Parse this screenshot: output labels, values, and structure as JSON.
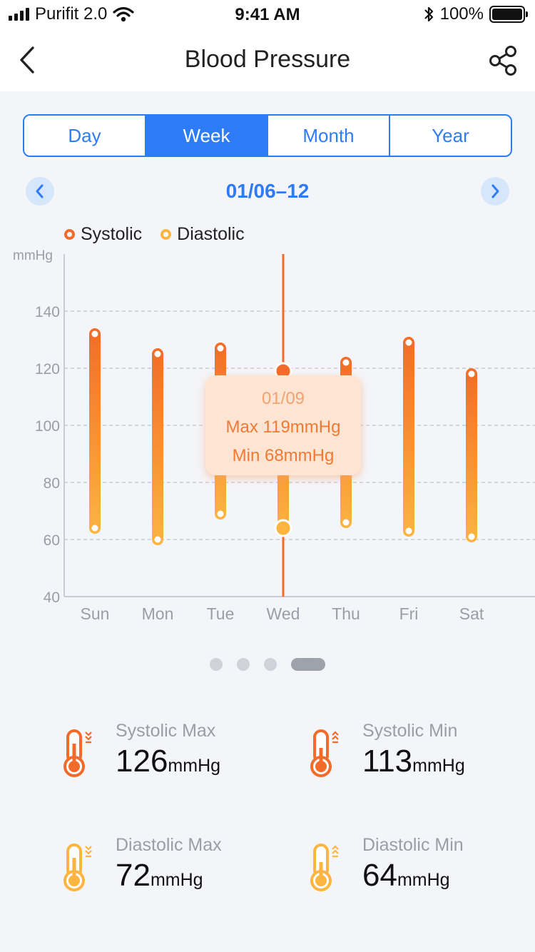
{
  "status": {
    "carrier": "Purifit 2.0",
    "time": "9:41 AM",
    "battery": "100%"
  },
  "nav": {
    "title": "Blood Pressure",
    "back_icon": "chevron-left-icon",
    "share_icon": "share-icon"
  },
  "tabs": [
    {
      "label": "Day",
      "active": false
    },
    {
      "label": "Week",
      "active": true
    },
    {
      "label": "Month",
      "active": false
    },
    {
      "label": "Year",
      "active": false
    }
  ],
  "date_range": "01/06–12",
  "legend": {
    "systolic": "Systolic",
    "diastolic": "Diastolic"
  },
  "colors": {
    "accent": "#2d7cf6",
    "systolic": "#f26b2a",
    "diastolic": "#fbb540",
    "tooltip_bg": "#fde4d3"
  },
  "chart_data": {
    "type": "range-bar",
    "unit_label": "mmHg",
    "categories": [
      "Sun",
      "Mon",
      "Tue",
      "Wed",
      "Thu",
      "Fri",
      "Sat"
    ],
    "systolic": [
      132,
      125,
      127,
      119,
      122,
      129,
      118
    ],
    "diastolic": [
      64,
      60,
      69,
      64,
      66,
      63,
      61
    ],
    "y_ticks": [
      "140",
      "120",
      "100",
      "80",
      "60",
      "40"
    ],
    "ylim": [
      40,
      160
    ],
    "grid": true,
    "selected_index": 3
  },
  "tooltip": {
    "date": "01/09",
    "max": "Max 119mmHg",
    "min": "Min 68mmHg"
  },
  "pager": {
    "count": 4,
    "active": 3
  },
  "stats": {
    "systolic_max": {
      "label": "Systolic Max",
      "value": "126",
      "unit": "mmHg"
    },
    "systolic_min": {
      "label": "Systolic Min",
      "value": "113",
      "unit": "mmHg"
    },
    "diastolic_max": {
      "label": "Diastolic Max",
      "value": "72",
      "unit": "mmHg"
    },
    "diastolic_min": {
      "label": "Diastolic Min",
      "value": "64",
      "unit": "mmHg"
    }
  }
}
